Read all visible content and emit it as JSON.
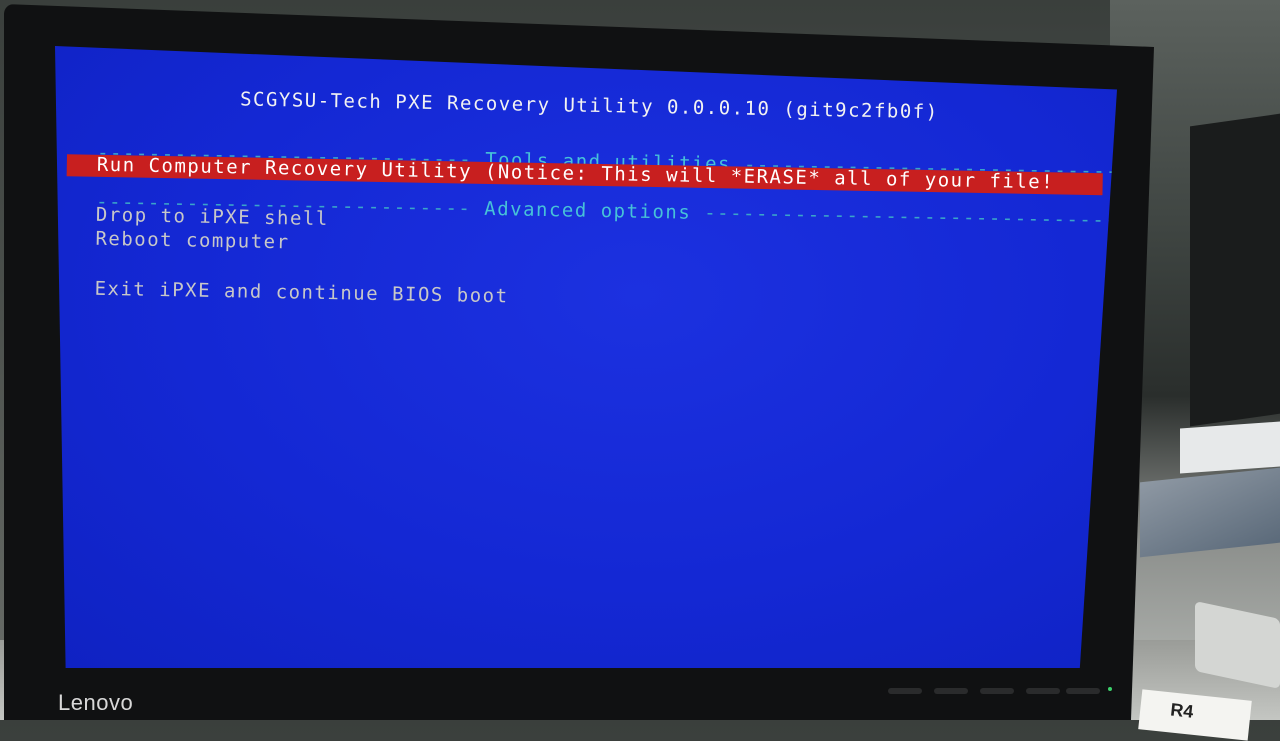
{
  "screen": {
    "title": "SCGYSU-Tech PXE Recovery Utility 0.0.0.10 (git9c2fb0f)",
    "sections": {
      "tools": {
        "label": "Tools and utilities",
        "left_dashes": "-----------------------------",
        "right_dashes": "------------------------------"
      },
      "advanced": {
        "label": "Advanced options",
        "left_dashes": "-----------------------------",
        "right_dashes": "---------------------------------"
      }
    },
    "menu": {
      "selected": "Run Computer Recovery Utility (Notice: This will *ERASE* all of your file!",
      "items": [
        "Drop to iPXE shell",
        "Reboot computer",
        "Exit iPXE and continue BIOS boot"
      ]
    }
  },
  "monitor": {
    "brand": "Lenovo"
  },
  "desk_label": "R4",
  "colors": {
    "screen_bg": "#1428d4",
    "highlight": "#c81f1f",
    "separator": "#3aa5c9",
    "text": "#c8c8c8"
  }
}
